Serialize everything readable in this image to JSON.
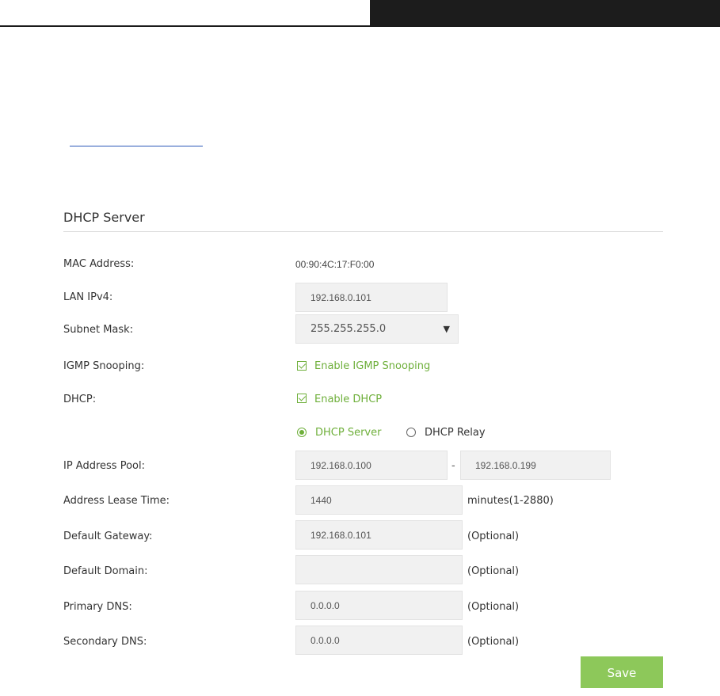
{
  "section": {
    "title": "DHCP Server"
  },
  "fields": {
    "mac": {
      "label": "MAC Address:",
      "value": "00:90:4C:17:F0:00"
    },
    "lan": {
      "label": "LAN IPv4:",
      "value": "192.168.0.101"
    },
    "subnet": {
      "label": "Subnet Mask:",
      "value": "255.255.255.0"
    },
    "igmp": {
      "label": "IGMP Snooping:",
      "option": "Enable IGMP Snooping",
      "checked": true
    },
    "dhcp": {
      "label": "DHCP:",
      "option": "Enable DHCP",
      "checked": true
    },
    "mode": {
      "server": "DHCP Server",
      "relay": "DHCP Relay",
      "selected": "DHCP Server"
    },
    "pool": {
      "label": "IP Address Pool:",
      "start": "192.168.0.100",
      "separator": "-",
      "end": "192.168.0.199"
    },
    "lease": {
      "label": "Address Lease Time:",
      "value": "1440",
      "suffix": "minutes(1-2880)"
    },
    "gateway": {
      "label": "Default Gateway:",
      "value": "192.168.0.101",
      "suffix": "(Optional)"
    },
    "domain": {
      "label": "Default Domain:",
      "value": "",
      "suffix": "(Optional)"
    },
    "primary_dns": {
      "label": "Primary DNS:",
      "value": "0.0.0.0",
      "suffix": "(Optional)"
    },
    "secondary_dns": {
      "label": "Secondary DNS:",
      "value": "0.0.0.0",
      "suffix": "(Optional)"
    }
  },
  "save_label": "Save",
  "colors": {
    "accent": "#6eaf3a",
    "save_button": "#8dc85a",
    "field_bg": "#f1f1f1"
  }
}
